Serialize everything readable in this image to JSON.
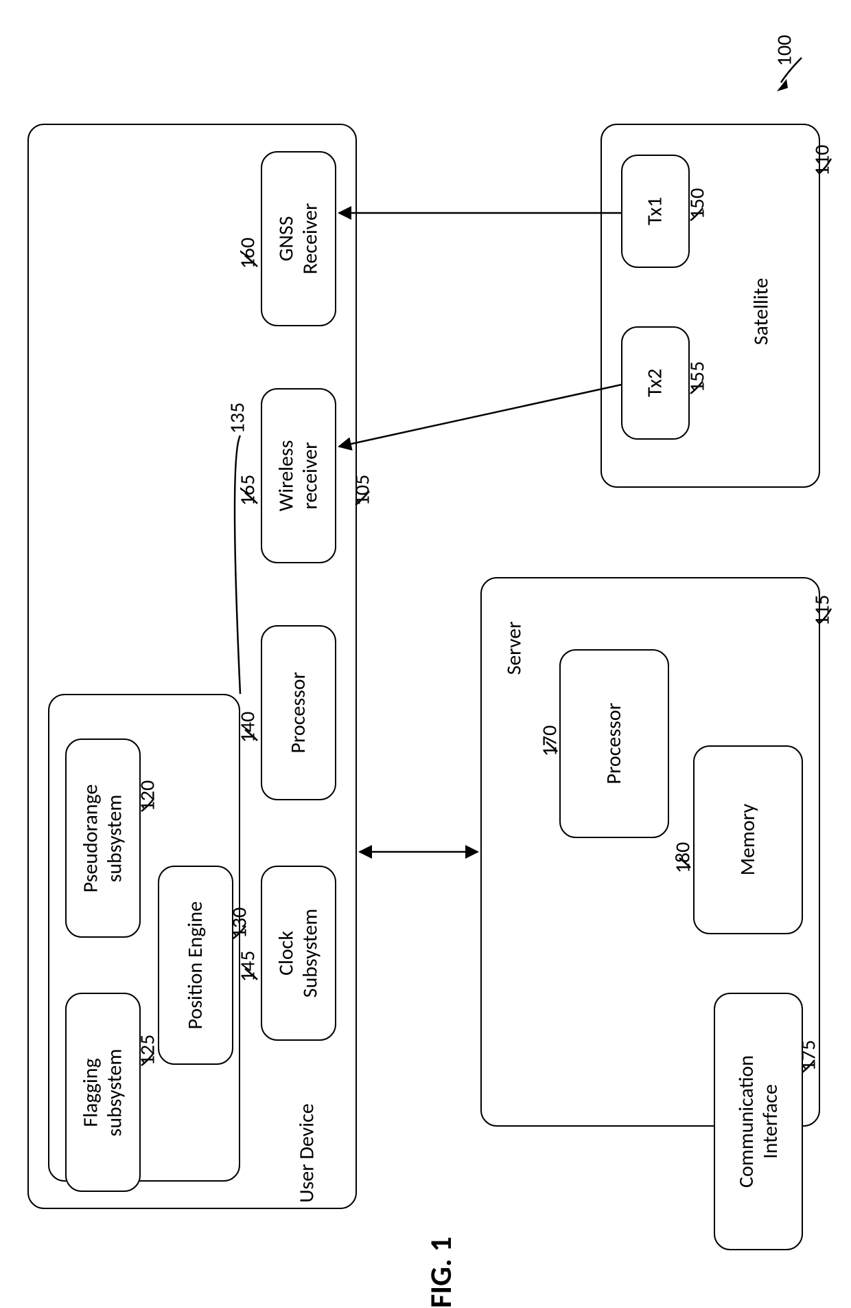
{
  "figure_label": "FIG. 1",
  "refs": {
    "system": "100",
    "user_device": "105",
    "satellite": "110",
    "server": "115",
    "pseudorange": "120",
    "flagging": "125",
    "position_engine": "130",
    "subgroup_135": "135",
    "processor_ud": "140",
    "clock": "145",
    "tx1": "150",
    "tx2": "155",
    "gnss": "160",
    "wireless": "165",
    "processor_srv": "170",
    "comm_if": "175",
    "memory": "180"
  },
  "labels": {
    "user_device": "User Device",
    "satellite": "Satellite",
    "server": "Server",
    "gnss": "GNSS\nReceiver",
    "wireless": "Wireless\nreceiver",
    "processor_ud": "Processor",
    "clock": "Clock\nSubsystem",
    "pseudorange": "Pseudorange\nsubsystem",
    "flagging": "Flagging\nsubsystem",
    "position_engine": "Position Engine",
    "tx1": "Tx1",
    "tx2": "Tx2",
    "processor_srv": "Processor",
    "memory": "Memory",
    "comm_if": "Communication\nInterface"
  }
}
